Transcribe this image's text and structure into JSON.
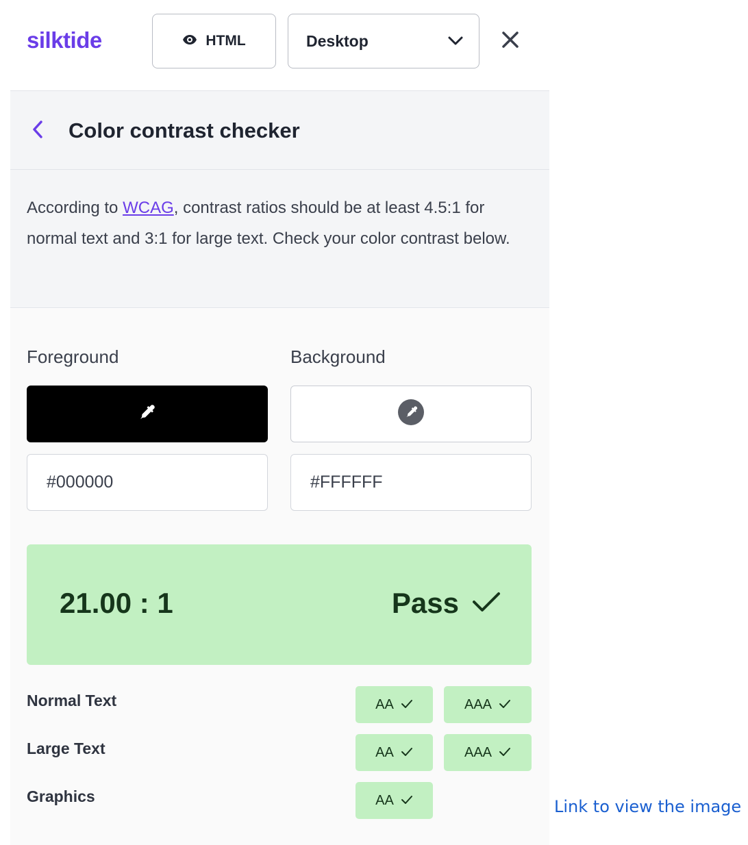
{
  "app": {
    "logo": "silktide"
  },
  "toolbar": {
    "view_button": {
      "label": "HTML",
      "icon": "eye-icon"
    },
    "device_select": {
      "selected": "Desktop",
      "icon": "chevron-down-icon"
    },
    "close_icon": "close-icon"
  },
  "header": {
    "title": "Color contrast checker",
    "back_icon": "chevron-left-icon"
  },
  "description": {
    "before_link": "According to ",
    "link_text": "WCAG",
    "after_link": ", contrast ratios should be at least 4.5:1 for normal text and 3:1 for large text. Check your color contrast below."
  },
  "foreground": {
    "label": "Foreground",
    "value": "#000000",
    "picker_icon": "eyedropper-icon"
  },
  "background": {
    "label": "Background",
    "value": "#FFFFFF",
    "picker_icon": "eyedropper-icon"
  },
  "result": {
    "ratio": "21.00 : 1",
    "status": "Pass",
    "status_icon": "check-icon"
  },
  "criteria": [
    {
      "label": "Normal Text",
      "badges": [
        "AA",
        "AAA"
      ]
    },
    {
      "label": "Large Text",
      "badges": [
        "AA",
        "AAA"
      ]
    },
    {
      "label": "Graphics",
      "badges": [
        "AA"
      ]
    }
  ],
  "footer_link": "Link to view the image",
  "colors": {
    "brand": "#6a3de8",
    "pass_bg": "#c2f0c2",
    "pass_text": "#16361b",
    "link": "#1a5fd0"
  }
}
